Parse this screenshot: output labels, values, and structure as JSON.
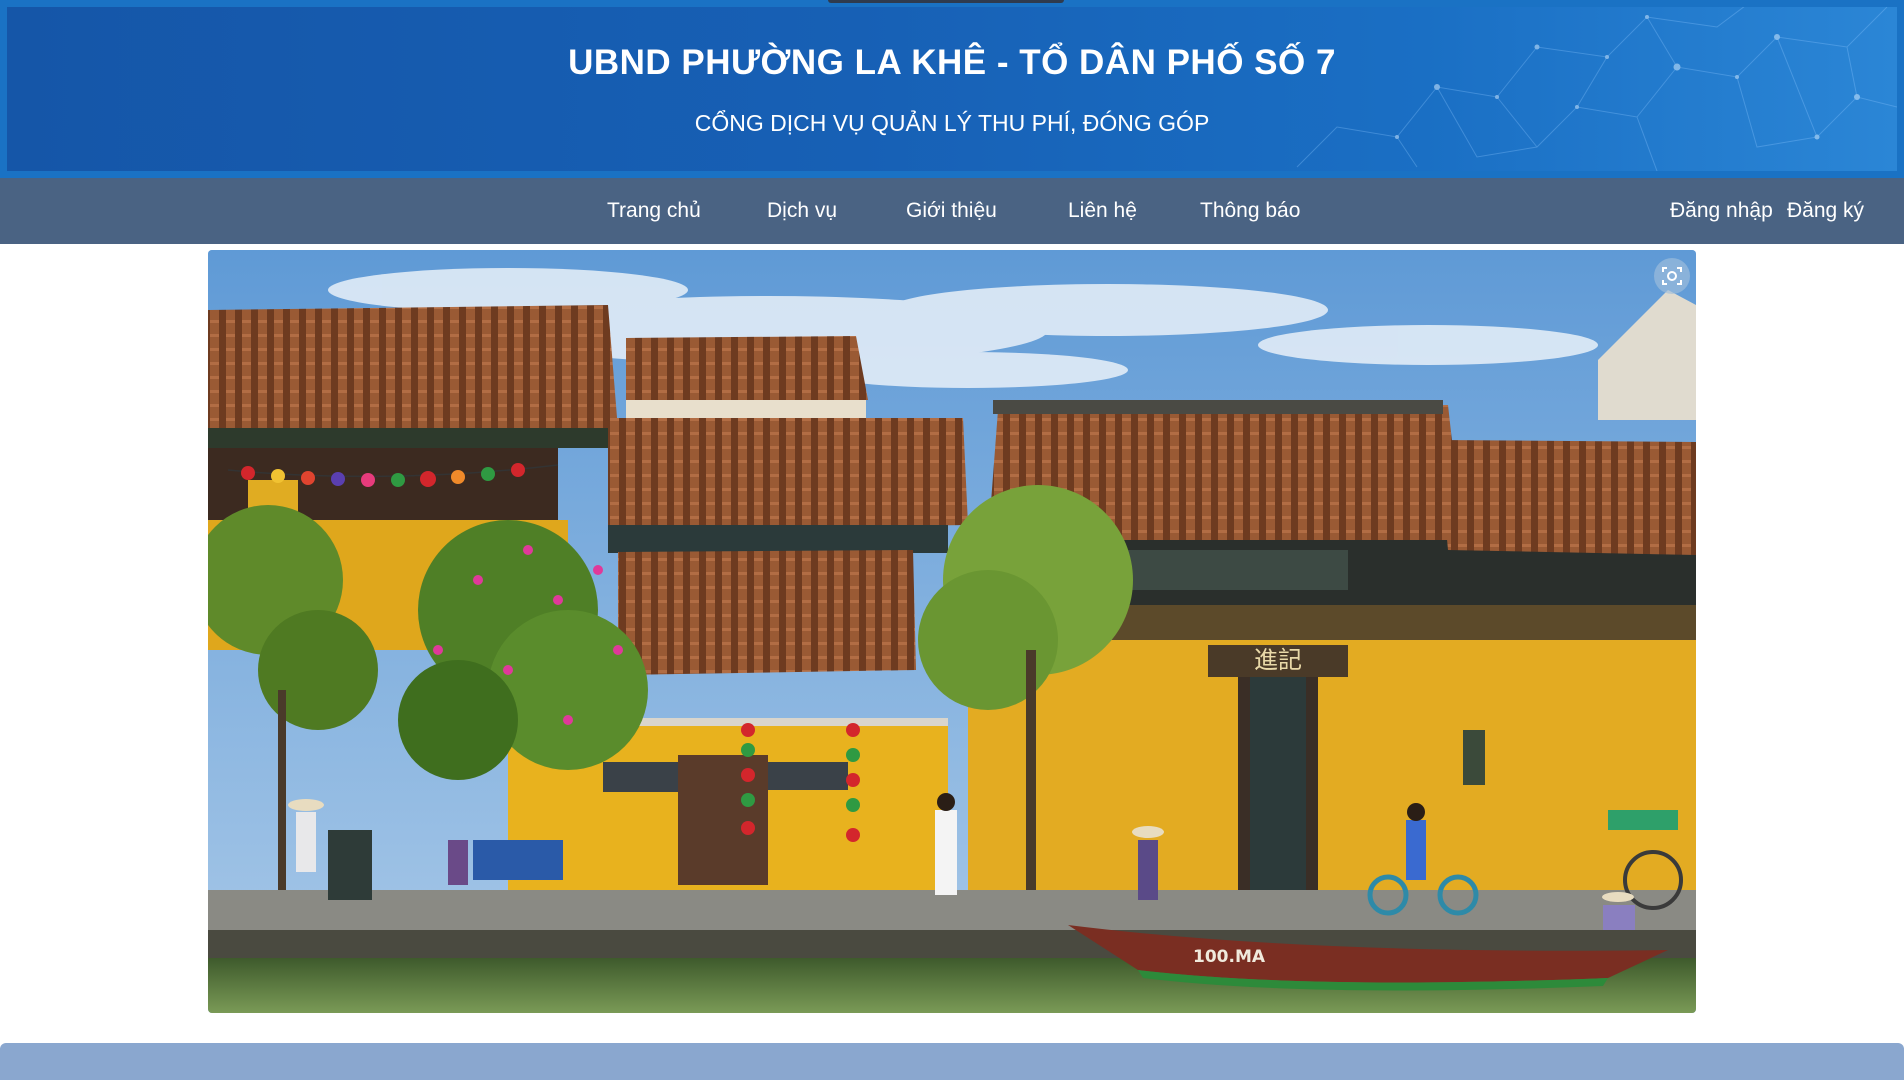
{
  "header": {
    "title": "UBND PHƯỜNG LA KHÊ - TỔ DÂN PHỐ SỐ 7",
    "subtitle": "CỔNG DỊCH VỤ QUẢN LÝ THU PHÍ, ĐÓNG GÓP"
  },
  "nav": {
    "items": [
      {
        "label": "Trang chủ"
      },
      {
        "label": "Dịch vụ"
      },
      {
        "label": "Giới thiệu"
      },
      {
        "label": "Liên hệ"
      },
      {
        "label": "Thông báo"
      }
    ],
    "login_label": "Đăng nhập",
    "register_label": "Đăng ký"
  },
  "hero": {
    "boat_label": "100.MA",
    "sign_text": "進記",
    "screenshot_icon": "screenshot-capture-icon"
  },
  "colors": {
    "banner": "#1760b5",
    "nav": "#4a6383",
    "footer": "#8aa7cf",
    "wall_yellow": "#e8b21e"
  }
}
